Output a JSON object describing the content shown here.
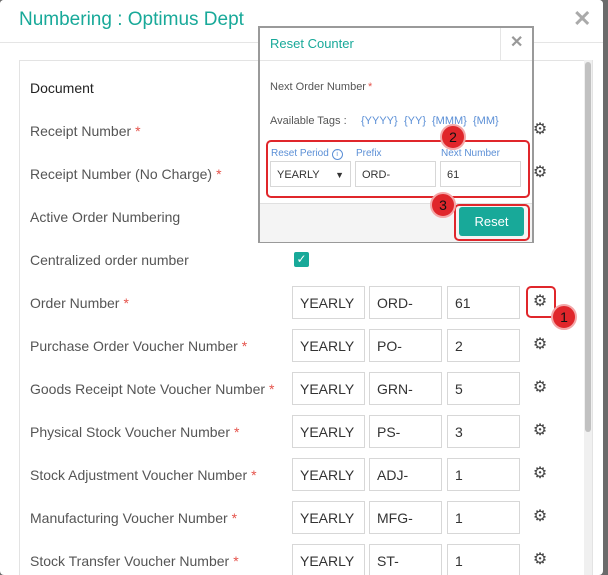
{
  "modal": {
    "title": "Numbering : Optimus Dept",
    "close_icon": "close-icon"
  },
  "document_label": "Document",
  "rows": [
    {
      "label": "Receipt Number",
      "required": true
    },
    {
      "label": "Receipt Number (No Charge)",
      "required": true
    },
    {
      "label": "Active Order Numbering",
      "required": false
    },
    {
      "label": "Centralized order number",
      "required": false
    },
    {
      "label": "Order Number",
      "required": true,
      "period": "YEARLY",
      "prefix": "ORD-",
      "next": "61"
    },
    {
      "label": "Purchase Order Voucher Number",
      "required": true,
      "period": "YEARLY",
      "prefix": "PO-",
      "next": "2"
    },
    {
      "label": "Goods Receipt Note Voucher Number",
      "required": true,
      "period": "YEARLY",
      "prefix": "GRN-",
      "next": "5"
    },
    {
      "label": "Physical Stock Voucher Number",
      "required": true,
      "period": "YEARLY",
      "prefix": "PS-",
      "next": "3"
    },
    {
      "label": "Stock Adjustment Voucher Number",
      "required": true,
      "period": "YEARLY",
      "prefix": "ADJ-",
      "next": "1"
    },
    {
      "label": "Manufacturing Voucher Number",
      "required": true,
      "period": "YEARLY",
      "prefix": "MFG-",
      "next": "1"
    },
    {
      "label": "Stock Transfer Voucher Number",
      "required": true,
      "period": "YEARLY",
      "prefix": "ST-",
      "next": "1"
    }
  ],
  "required_mark": "*",
  "popup": {
    "title": "Reset Counter",
    "next_order_label": "Next Order Number",
    "available_tags_label": "Available Tags :",
    "tags": [
      "{YYYY}",
      "{YY}",
      "{MMM}",
      "{MM}"
    ],
    "reset_period_label": "Reset Period",
    "prefix_label": "Prefix",
    "next_number_label": "Next Number",
    "reset_period_value": "YEARLY",
    "prefix_value": "ORD-",
    "next_number_value": "61",
    "reset_button": "Reset"
  },
  "annotations": [
    "1",
    "2",
    "3"
  ],
  "colors": {
    "accent": "#18a999",
    "annotation": "#e0262b"
  }
}
